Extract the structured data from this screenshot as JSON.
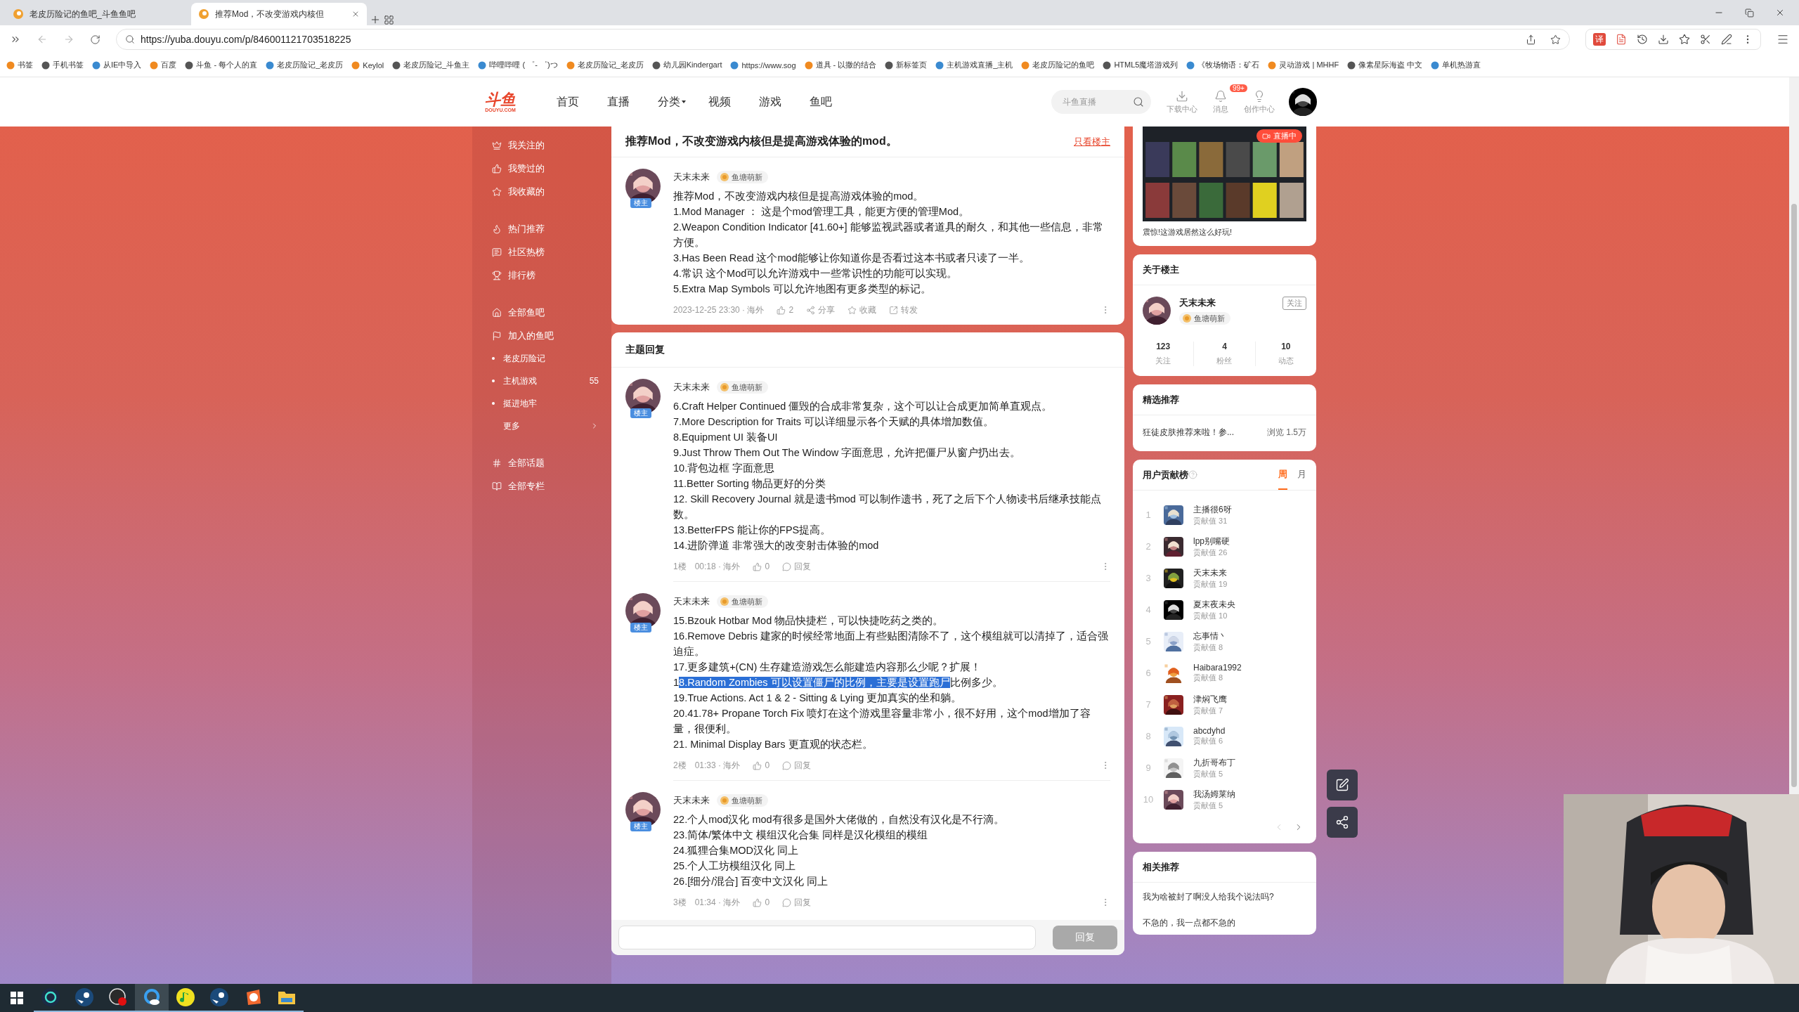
{
  "browser": {
    "tabs": [
      {
        "title": "老皮历险记的鱼吧_斗鱼鱼吧",
        "selected": false
      },
      {
        "title": "推荐Mod，不改变游戏内核但",
        "selected": true
      }
    ],
    "url": "https://yuba.douyu.com/p/846001121703518225",
    "translate_label": "译",
    "bookmarks": [
      "书签",
      "手机书签",
      "从IE中导入",
      "百度",
      "斗鱼 - 每个人的直",
      "老皮历险记_老皮历",
      "Keylol",
      "老皮历险记_斗鱼主",
      "哔哩哔哩 ( ゜- ゜)つ",
      "老皮历险记_老皮历",
      "幼儿园Kindergart",
      "https://www.sog",
      "道具 - 以撒的结合",
      "新标签页",
      "主机游戏直播_主机",
      "老皮历险记的鱼吧",
      "HTML5魔塔游戏列",
      "《牧场物语：矿石",
      "灵动游戏 | MHHF",
      "像素星际海盗 中文",
      "单机热游直"
    ]
  },
  "header": {
    "logo": "斗鱼",
    "logo_sub": "DOUYU.COM",
    "nav": [
      {
        "label": "首页",
        "dropdown": false
      },
      {
        "label": "直播",
        "dropdown": false
      },
      {
        "label": "分类",
        "dropdown": true
      },
      {
        "label": "视频",
        "dropdown": false
      },
      {
        "label": "游戏",
        "dropdown": false
      },
      {
        "label": "鱼吧",
        "dropdown": false
      }
    ],
    "search": {
      "placeholder": "斗鱼直播"
    },
    "tools": [
      {
        "kind": "download",
        "label": "下载中心"
      },
      {
        "kind": "bell",
        "label": "消息",
        "badge": "99+"
      },
      {
        "kind": "bulb",
        "label": "创作中心"
      }
    ]
  },
  "sidebar": {
    "sections": [
      {
        "items": [
          {
            "kind": "link",
            "label": "我关注的"
          },
          {
            "kind": "link",
            "label": "我赞过的"
          },
          {
            "kind": "link",
            "label": "我收藏的"
          }
        ]
      },
      {
        "items": [
          {
            "kind": "link",
            "label": "热门推荐"
          },
          {
            "kind": "link",
            "label": "社区热榜"
          },
          {
            "kind": "link",
            "label": "排行榜"
          }
        ]
      },
      {
        "items": [
          {
            "kind": "link",
            "label": "全部鱼吧"
          },
          {
            "kind": "link",
            "label": "加入的鱼吧"
          },
          {
            "kind": "sub",
            "label": "老皮历险记"
          },
          {
            "kind": "sub",
            "label": "主机游戏",
            "count": "55"
          },
          {
            "kind": "sub",
            "label": "挺进地牢"
          },
          {
            "kind": "more",
            "label": "更多"
          }
        ]
      },
      {
        "items": [
          {
            "kind": "link",
            "label": "全部话题"
          },
          {
            "kind": "link",
            "label": "全部专栏"
          }
        ]
      }
    ]
  },
  "post": {
    "title": "推荐Mod，不改变游戏内核但是提高游戏体验的mod。",
    "filter_link": "只看楼主",
    "author": {
      "name": "天末未来",
      "role": "楼主",
      "level": "鱼塘萌新"
    },
    "lines": [
      "推荐Mod，不改变游戏内核但是提高游戏体验的mod。",
      "1.Mod Manager ： 这是个mod管理工具，能更方便的管理Mod。",
      "2.Weapon Condition Indicator [41.60+] 能够监视武器或者道具的耐久，和其他一些信息，非常方便。",
      "3.Has Been Read 这个mod能够让你知道你是否看过这本书或者只读了一半。",
      "4.常识 这个Mod可以允许游戏中一些常识性的功能可以实现。",
      "5.Extra Map Symbols 可以允许地图有更多类型的标记。"
    ],
    "time": "2023-12-25 23:30 · 海外",
    "likes": "2",
    "actions": [
      {
        "kind": "share",
        "label": "分享"
      },
      {
        "kind": "star",
        "label": "收藏"
      },
      {
        "kind": "forward",
        "label": "转发"
      }
    ]
  },
  "replies": {
    "title": "主题回复",
    "items": [
      {
        "author": {
          "name": "天末未来",
          "role": "楼主",
          "level": "鱼塘萌新"
        },
        "lines": [
          "6.Craft Helper Continued 僵毁的合成非常复杂，这个可以让合成更加简单直观点。",
          "7.More Description for Traits 可以详细显示各个天赋的具体增加数值。",
          "8.Equipment UI 装备UI",
          "9.Just Throw Them Out The Window 字面意思，允许把僵尸从窗户扔出去。",
          "10.背包边框 字面意思",
          "11.Better Sorting 物品更好的分类",
          "12. Skill Recovery Journal 就是遗书mod 可以制作遗书，死了之后下个人物读书后继承技能点数。",
          "13.BetterFPS 能让你的FPS提高。",
          "14.进阶弹道 非常强大的改变射击体验的mod"
        ],
        "floor": "1楼",
        "time": "00:18 · 海外",
        "likes": "0",
        "reply": "回复"
      },
      {
        "author": {
          "name": "天末未来",
          "role": "楼主",
          "level": "鱼塘萌新"
        },
        "lines": [
          "15.Bzouk Hotbar Mod 物品快捷栏，可以快捷吃药之类的。",
          "16.Remove Debris 建家的时候经常地面上有些贴图清除不了，这个模组就可以清掉了，适合强迫症。",
          "17.更多建筑+(CN) 生存建造游戏怎么能建造内容那么少呢？扩展！",
          {
            "segments": [
              {
                "text": "1",
                "selected": false
              },
              {
                "text": "8.Random Zombies 可以设置僵尸的比例，主要是设置跑尸",
                "selected": true
              },
              {
                "text": "比例多少。",
                "selected": false
              }
            ]
          },
          "19.True Actions. Act 1 & 2 - Sitting & Lying 更加真实的坐和躺。",
          "20.41.78+ Propane Torch Fix 喷灯在这个游戏里容量非常小，很不好用，这个mod增加了容量，很便利。",
          "21. Minimal Display Bars 更直观的状态栏。"
        ],
        "floor": "2楼",
        "time": "01:33 · 海外",
        "likes": "0",
        "reply": "回复"
      },
      {
        "author": {
          "name": "天末未来",
          "role": "楼主",
          "level": "鱼塘萌新"
        },
        "lines": [
          "22.个人mod汉化 mod有很多是国外大佬做的，自然没有汉化是不行滴。",
          "23.简体/繁体中文 模组汉化合集 同样是汉化模组的模组",
          "24.狐狸合集MOD汉化 同上",
          "25.个人工坊模组汉化 同上",
          "26.[细分/混合] 百变中文汉化 同上"
        ],
        "floor": "3楼",
        "time": "01:34 · 海外",
        "likes": "0",
        "reply": "回复"
      }
    ],
    "input": {
      "button": "回复",
      "disabled": true
    }
  },
  "right": {
    "live": {
      "badge": "直播中",
      "caption": "震惊!这游戏居然这么好玩!"
    },
    "about": {
      "title": "关于楼主",
      "name": "天末未来",
      "level": "鱼塘萌新",
      "follow": "关注",
      "stats": [
        {
          "value": "123",
          "label": "关注"
        },
        {
          "value": "4",
          "label": "粉丝"
        },
        {
          "value": "10",
          "label": "动态"
        }
      ]
    },
    "featured": {
      "title": "精选推荐",
      "items": [
        {
          "text": "狂徒皮肤推荐来啦！参...",
          "views": "浏览 1.5万"
        }
      ]
    },
    "ranking": {
      "title": "用户贡献榜",
      "tabs": [
        {
          "label": "周",
          "selected": true
        },
        {
          "label": "月",
          "selected": false
        }
      ],
      "rows": [
        {
          "rank": "1",
          "name": "主播很6呀",
          "score": "贡献值 31"
        },
        {
          "rank": "2",
          "name": "lpp别嘴硬",
          "score": "贡献值 26"
        },
        {
          "rank": "3",
          "name": "天末未来",
          "score": "贡献值 19"
        },
        {
          "rank": "4",
          "name": "夏末夜未央",
          "score": "贡献值 10"
        },
        {
          "rank": "5",
          "name": "忘事情丶",
          "score": "贡献值 8"
        },
        {
          "rank": "6",
          "name": "Haibara1992",
          "score": "贡献值 8"
        },
        {
          "rank": "7",
          "name": "津焖飞鹰",
          "score": "贡献值 7"
        },
        {
          "rank": "8",
          "name": "abcdyhd",
          "score": "贡献值 6"
        },
        {
          "rank": "9",
          "name": "九折哥布丁",
          "score": "贡献值 5"
        },
        {
          "rank": "10",
          "name": "我汤姆莱纳",
          "score": "贡献值 5"
        }
      ]
    },
    "related": {
      "title": "相关推荐",
      "items": [
        "我为啥被封了啊没人给我个说法吗?",
        "不急的，我一点都不急的"
      ]
    }
  },
  "taskbar": {
    "apps": [
      {
        "kind": "ring",
        "selected": false
      },
      {
        "kind": "steam",
        "selected": false
      },
      {
        "kind": "record",
        "selected": false
      },
      {
        "kind": "browser",
        "selected": true
      },
      {
        "kind": "music",
        "selected": false
      },
      {
        "kind": "steam",
        "selected": false
      },
      {
        "kind": "mascot",
        "selected": false
      },
      {
        "kind": "folder",
        "selected": false
      }
    ]
  }
}
